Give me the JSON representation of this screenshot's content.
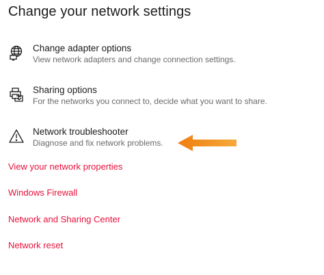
{
  "page": {
    "title": "Change your network settings"
  },
  "options": [
    {
      "icon": "globe-monitor-icon",
      "title": "Change adapter options",
      "description": "View network adapters and change connection settings."
    },
    {
      "icon": "sharing-printer-icon",
      "title": "Sharing options",
      "description": "For the networks you connect to, decide what you want to share."
    },
    {
      "icon": "warning-triangle-icon",
      "title": "Network troubleshooter",
      "description": "Diagnose and fix network problems."
    }
  ],
  "links": [
    "View your network properties",
    "Windows Firewall",
    "Network and Sharing Center",
    "Network reset"
  ],
  "colors": {
    "link": "#e8103a",
    "annotation_arrow": "#f28a18",
    "description": "#6a6a6a"
  },
  "annotation": {
    "icon": "orange-arrow-left-icon"
  }
}
